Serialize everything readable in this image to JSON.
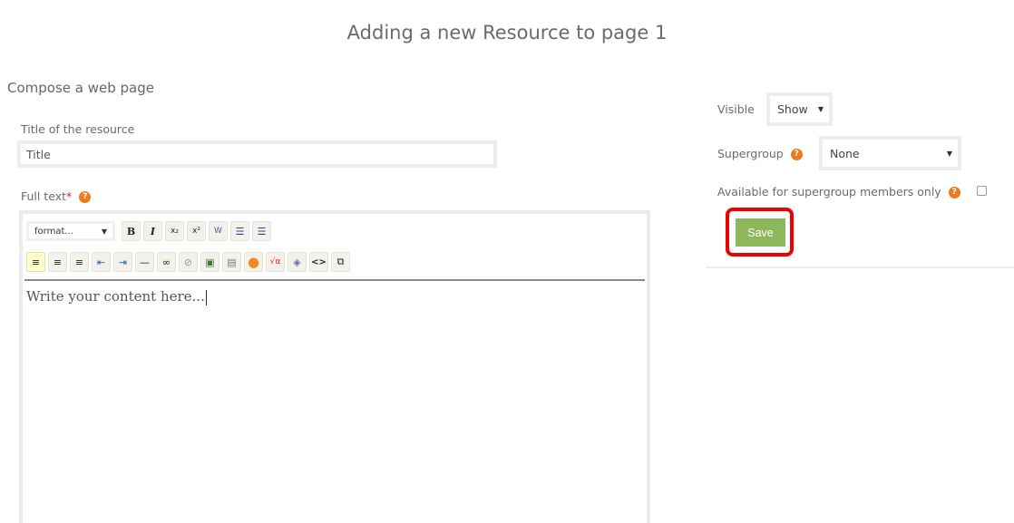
{
  "page": {
    "title": "Adding a new Resource to page 1",
    "section_title": "Compose a web page"
  },
  "form": {
    "title_label": "Title of the resource",
    "title_value": "Title",
    "fulltext_label": "Full text",
    "required_mark": "*",
    "help_glyph": "?"
  },
  "editor": {
    "format_select": "format...",
    "toolbar_row1": [
      {
        "icon": "bold-icon",
        "glyph": "B"
      },
      {
        "icon": "italic-icon",
        "glyph": "I"
      },
      {
        "icon": "subscript-icon",
        "glyph": "x₂"
      },
      {
        "icon": "superscript-icon",
        "glyph": "x²"
      },
      {
        "icon": "paste-from-word-icon",
        "glyph": "W"
      },
      {
        "icon": "ordered-list-icon",
        "glyph": "☰"
      },
      {
        "icon": "unordered-list-icon",
        "glyph": "☰"
      }
    ],
    "toolbar_row2": [
      {
        "icon": "align-left-icon",
        "glyph": "≡",
        "active": true
      },
      {
        "icon": "align-center-icon",
        "glyph": "≡"
      },
      {
        "icon": "align-right-icon",
        "glyph": "≡"
      },
      {
        "icon": "outdent-icon",
        "glyph": "⇤"
      },
      {
        "icon": "indent-icon",
        "glyph": "⇥"
      },
      {
        "icon": "horizontal-rule-icon",
        "glyph": "—"
      },
      {
        "icon": "link-icon",
        "glyph": "∞"
      },
      {
        "icon": "unlink-icon",
        "glyph": "⊘"
      },
      {
        "icon": "image-icon",
        "glyph": "▣"
      },
      {
        "icon": "media-icon",
        "glyph": "▤"
      },
      {
        "icon": "embed-icon",
        "glyph": "●"
      },
      {
        "icon": "math-icon",
        "glyph": "√α"
      },
      {
        "icon": "3d-object-icon",
        "glyph": "◈"
      },
      {
        "icon": "source-code-icon",
        "glyph": "<>"
      },
      {
        "icon": "fullscreen-icon",
        "glyph": "⧉"
      }
    ],
    "content_placeholder": "Write your content here..."
  },
  "sidebar": {
    "visible_label": "Visible",
    "visible_value": "Show",
    "supergroup_label": "Supergroup",
    "supergroup_value": "None",
    "members_only_label": "Available for supergroup members only",
    "members_only_checked": false,
    "save_label": "Save"
  },
  "colors": {
    "save_button": "#8cb85a",
    "help_icon": "#ee7a1e",
    "highlight_border": "#ee0000"
  }
}
